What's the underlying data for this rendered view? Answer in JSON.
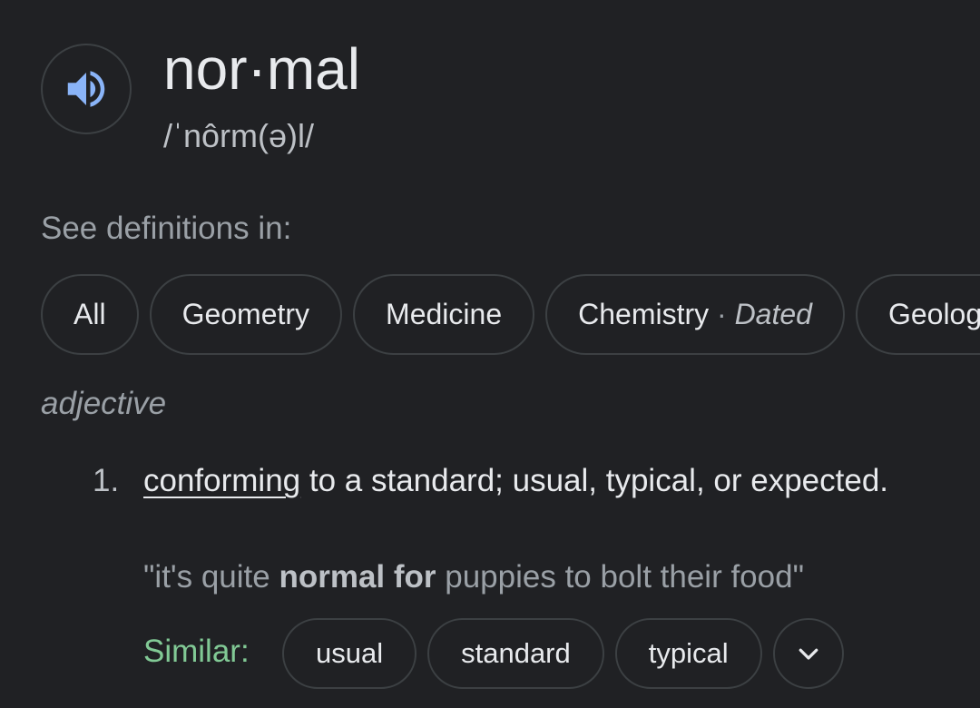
{
  "entry": {
    "headword": "nor·mal",
    "pronunciation": "/ˈnôrm(ə)l/"
  },
  "icons": {
    "speaker": "volume-up-icon",
    "expand": "chevron-down-icon"
  },
  "colors": {
    "background": "#202124",
    "speaker_icon": "#8ab4f8",
    "similar_label": "#81c995"
  },
  "see_definitions": {
    "label": "See definitions in:",
    "chips": [
      {
        "label": "All"
      },
      {
        "label": "Geometry"
      },
      {
        "label": "Medicine"
      },
      {
        "label": "Chemistry",
        "separator": " · ",
        "note": "Dated"
      },
      {
        "label": "Geology"
      }
    ]
  },
  "part_of_speech": "adjective",
  "senses": [
    {
      "number": "1.",
      "link_word": "conforming",
      "definition_rest": " to a standard; usual, typical, or expected.",
      "example": {
        "open": "\"it's quite ",
        "bold": "normal for",
        "close": " puppies to bolt their food\""
      },
      "similar": {
        "label": "Similar:",
        "words": [
          "usual",
          "standard",
          "typical"
        ]
      }
    }
  ]
}
